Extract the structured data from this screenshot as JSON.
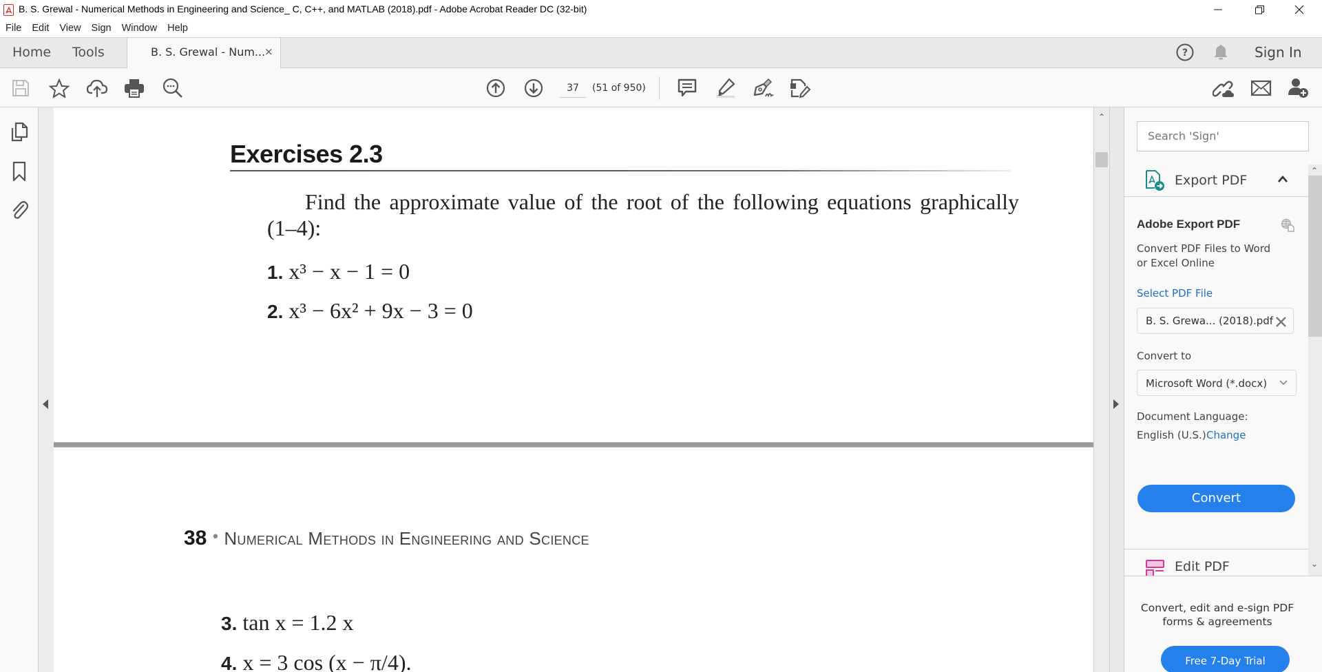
{
  "window": {
    "title": "B. S. Grewal - Numerical Methods in Engineering and Science_ C, C++, and MATLAB (2018).pdf - Adobe Acrobat Reader DC (32-bit)",
    "controls": [
      "minimize",
      "restore",
      "close"
    ]
  },
  "menu": [
    "File",
    "Edit",
    "View",
    "Sign",
    "Window",
    "Help"
  ],
  "tabs": {
    "home": "Home",
    "tools": "Tools",
    "document": "B. S. Grewal - Num...",
    "close_glyph": "×",
    "sign_in": "Sign In"
  },
  "toolbar": {
    "left_icons": [
      "save-icon",
      "bookmark-star-icon",
      "upload-cloud-icon",
      "print-icon",
      "search-more-icon"
    ],
    "page_number": "37",
    "page_count": "(51 of 950)",
    "center_icons": [
      "prev-page-icon",
      "next-page-icon",
      "comment-icon",
      "highlight-icon",
      "sign-pen-icon",
      "edit-fill-icon"
    ],
    "right_icons": [
      "share-link-icon",
      "email-icon",
      "add-user-icon"
    ]
  },
  "left_rail": [
    "page-thumbnails-icon",
    "bookmarks-icon",
    "attachments-icon"
  ],
  "document": {
    "heading": "Exercises 2.3",
    "paragraph": "Find the approximate value of the root of the following equations graphically (1–4):",
    "items": [
      {
        "num": "1.",
        "expr": "x³ − x − 1 = 0"
      },
      {
        "num": "2.",
        "expr": "x³ − 6x² + 9x − 3 = 0"
      },
      {
        "num": "3.",
        "expr": "tan x = 1.2 x"
      },
      {
        "num": "4.",
        "expr": "x = 3 cos (x − π/4)."
      }
    ],
    "running_head": {
      "page": "38",
      "separator": "•",
      "title": "Numerical Methods in Engineering and Science"
    }
  },
  "right_panel": {
    "search_placeholder": "Search 'Sign'",
    "section_title": "Export PDF",
    "export": {
      "title": "Adobe Export PDF",
      "description": "Convert PDF Files to Word or Excel Online",
      "select_file_label": "Select PDF File",
      "selected_file": "B. S. Grewa... (2018).pdf",
      "convert_to_label": "Convert to",
      "convert_to_value": "Microsoft Word (*.docx)",
      "language_label": "Document Language:",
      "language_value": "English (U.S.)",
      "language_change": "Change",
      "convert_button": "Convert"
    },
    "next_section": "Edit PDF",
    "promo_text": "Convert, edit and e-sign PDF forms & agreements",
    "trial_button": "Free 7-Day Trial"
  },
  "colors": {
    "accent_blue": "#2680eb",
    "link_blue": "#1f6fc9",
    "export_teal": "#1d8c8c",
    "edit_pink": "#d6389a"
  }
}
